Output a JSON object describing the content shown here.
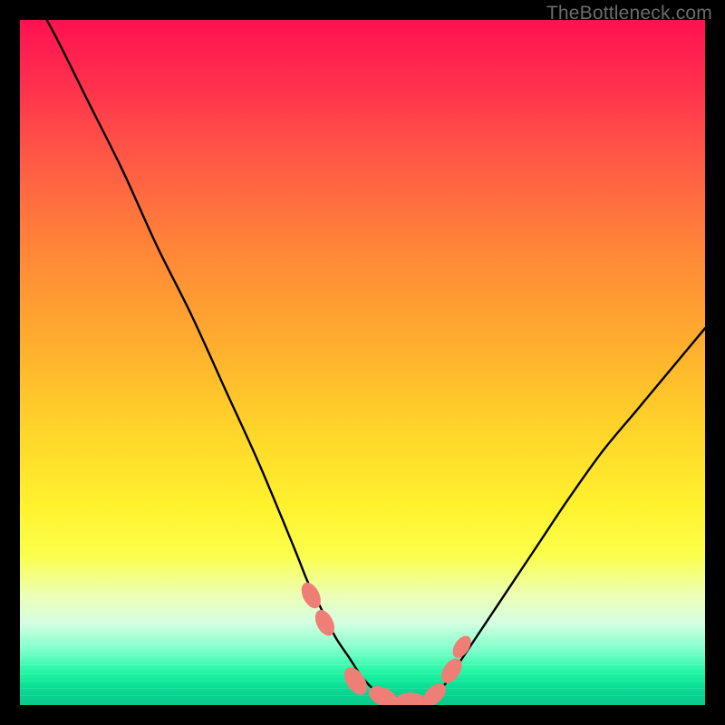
{
  "watermark": "TheBottleneck.com",
  "colors": {
    "frame": "#000000",
    "curve": "#000000",
    "marker_fill": "#ef7e77",
    "marker_stroke": "#e86a63"
  },
  "chart_data": {
    "type": "line",
    "title": "",
    "xlabel": "",
    "ylabel": "",
    "xlim": [
      0,
      100
    ],
    "ylim": [
      0,
      100
    ],
    "grid": false,
    "curve": {
      "x": [
        0,
        5,
        10,
        15,
        20,
        25,
        30,
        35,
        40,
        42,
        44,
        46,
        48,
        50,
        52,
        54,
        56,
        58,
        60,
        62,
        64,
        68,
        72,
        76,
        80,
        85,
        90,
        95,
        100
      ],
      "y": [
        107,
        98,
        88,
        78,
        67,
        57,
        46,
        35,
        23,
        18,
        14,
        10,
        7,
        4,
        2,
        1,
        0.4,
        0.4,
        1,
        3,
        6,
        12,
        18,
        24,
        30,
        37,
        43,
        49,
        55
      ]
    },
    "markers": [
      {
        "x": 42.5,
        "y": 16,
        "r": 9
      },
      {
        "x": 44.5,
        "y": 12,
        "r": 9
      },
      {
        "x": 49,
        "y": 3.5,
        "r": 10
      },
      {
        "x": 53,
        "y": 1.2,
        "r": 10
      },
      {
        "x": 57,
        "y": 0.5,
        "r": 10
      },
      {
        "x": 60.5,
        "y": 1.5,
        "r": 9
      },
      {
        "x": 63,
        "y": 5,
        "r": 9
      },
      {
        "x": 64.5,
        "y": 8.5,
        "r": 8
      }
    ],
    "note": "x/y in percent of plot area; y measured upward from bottom edge; no axis ticks or numeric labels are rendered in the source image."
  }
}
